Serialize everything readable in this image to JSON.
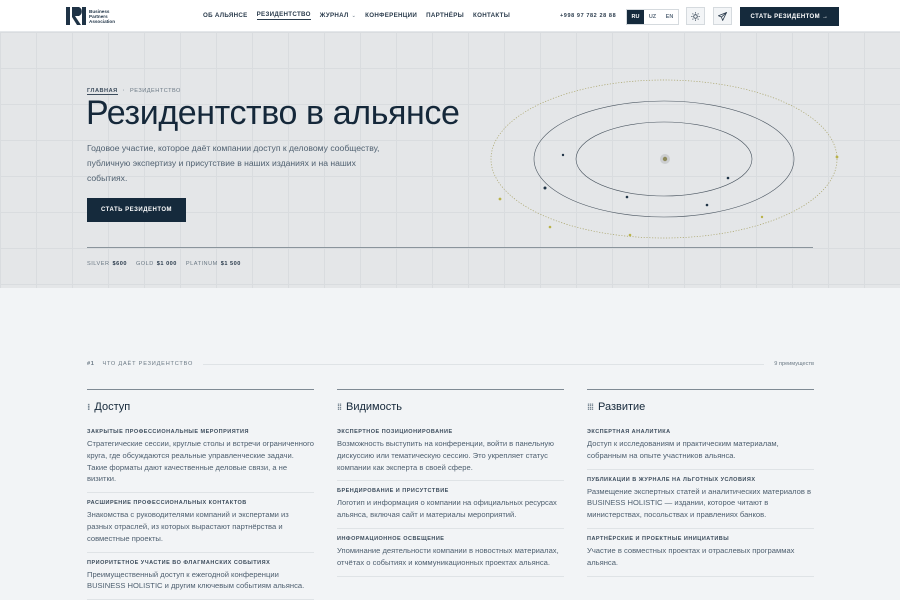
{
  "header": {
    "logo_text": "Business Partners Association",
    "nav": [
      {
        "label": "ОБ АЛЬЯНСЕ"
      },
      {
        "label": "РЕЗИДЕНТСТВО"
      },
      {
        "label": "ЖУРНАЛ"
      },
      {
        "label": "КОНФЕРЕНЦИИ"
      },
      {
        "label": "ПАРТНЁРЫ"
      },
      {
        "label": "КОНТАКТЫ"
      }
    ],
    "nav_dropdown_icon": "chevron-down-icon",
    "phone": "+998 97 782 28 88",
    "langs": [
      "RU",
      "UZ",
      "EN"
    ],
    "active_lang": "RU",
    "theme_icon": "sun-icon",
    "telegram_icon": "paper-plane-icon",
    "cta_label": "СТАТЬ РЕЗИДЕНТОМ →"
  },
  "hero": {
    "breadcrumb": {
      "home": "ГЛАВНАЯ",
      "current": "РЕЗИДЕНТСТВО"
    },
    "title": "Резидентство в альянсе",
    "description": "Годовое участие, которое даёт компании доступ к деловому сообществу, публичную экспертизу и присутствие в наших изданиях и на наших событиях.",
    "cta_label": "СТАТЬ РЕЗИДЕНТОМ",
    "tiers": [
      {
        "name": "SILVER",
        "price": "$600"
      },
      {
        "name": "GOLD",
        "price": "$1 000"
      },
      {
        "name": "PLATINUM",
        "price": "$1 500"
      }
    ],
    "accent_color": "#b9b24a",
    "dark_color": "#152a3c"
  },
  "benefits": {
    "number": "#1",
    "title": "ЧТО ДАЁТ РЕЗИДЕНТСТВО",
    "count": "9 преимуществ",
    "columns": [
      {
        "bullet": "⁝",
        "title": "Доступ",
        "items": [
          {
            "label": "ЗАКРЫТЫЕ ПРОФЕССИОНАЛЬНЫЕ МЕРОПРИЯТИЯ",
            "text": "Стратегические сессии, круглые столы и встречи ограниченного круга, где обсуждаются реальные управленческие задачи. Такие форматы дают качественные деловые связи, а не визитки."
          },
          {
            "label": "РАСШИРЕНИЕ ПРОФЕССИОНАЛЬНЫХ КОНТАКТОВ",
            "text": "Знакомства с руководителями компаний и экспертами из разных отраслей, из которых вырастают партнёрства и совместные проекты."
          },
          {
            "label": "ПРИОРИТЕТНОЕ УЧАСТИЕ ВО ФЛАГМАНСКИХ СОБЫТИЯХ",
            "text": "Преимущественный доступ к ежегодной конференции BUSINESS HOLISTIC и другим ключевым событиям альянса."
          }
        ]
      },
      {
        "bullet": "⁞⁞",
        "title": "Видимость",
        "items": [
          {
            "label": "ЭКСПЕРТНОЕ ПОЗИЦИОНИРОВАНИЕ",
            "text": "Возможность выступить на конференции, войти в панельную дискуссию или тематическую сессию. Это укрепляет статус компании как эксперта в своей сфере."
          },
          {
            "label": "БРЕНДИРОВАНИЕ И ПРИСУТСТВИЕ",
            "text": "Логотип и информация о компании на официальных ресурсах альянса, включая сайт и материалы мероприятий."
          },
          {
            "label": "ИНФОРМАЦИОННОЕ ОСВЕЩЕНИЕ",
            "text": "Упоминание деятельности компании в новостных материалах, отчётах о событиях и коммуникационных проектах альянса."
          }
        ]
      },
      {
        "bullet": "⁞⁞⁞",
        "title": "Развитие",
        "items": [
          {
            "label": "ЭКСПЕРТНАЯ АНАЛИТИКА",
            "text": "Доступ к исследованиям и практическим материалам, собранным на опыте участников альянса."
          },
          {
            "label": "ПУБЛИКАЦИИ В ЖУРНАЛЕ НА ЛЬГОТНЫХ УСЛОВИЯХ",
            "text": "Размещение экспертных статей и аналитических материалов в BUSINESS HOLISTIC — издании, которое читают в министерствах, посольствах и правлениях банков."
          },
          {
            "label": "ПАРТНЁРСКИЕ И ПРОЕКТНЫЕ ИНИЦИАТИВЫ",
            "text": "Участие в совместных проектах и отраслевых программах альянса."
          }
        ]
      }
    ]
  }
}
